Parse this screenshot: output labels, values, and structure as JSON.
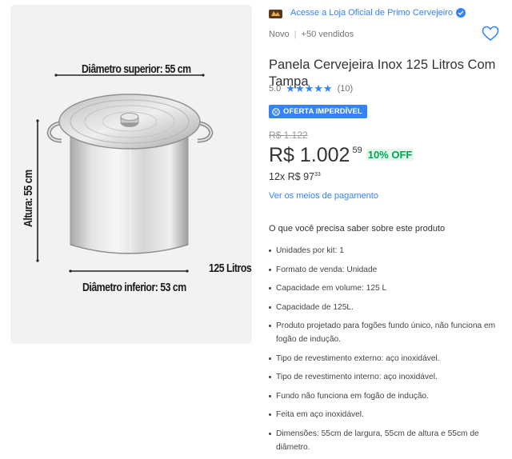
{
  "gallery": {
    "image_alt": "Panela cervejeira inox com tampa",
    "labels": {
      "top_diameter": "Diâmetro superior: 55 cm",
      "bottom_diameter": "Diâmetro inferior: 53 cm",
      "height": "Altura: 55 cm",
      "volume": "125 Litros"
    }
  },
  "store": {
    "link_text": "Acesse a Loja Oficial de Primo Cervejeiro"
  },
  "meta": {
    "condition": "Novo",
    "separator": "|",
    "sold": "+50 vendidos"
  },
  "product": {
    "title": "Panela Cervejeira Inox 125 Litros Com Tampa",
    "rating_value": "5.0",
    "rating_stars": "★★★★★",
    "rating_count": "(10)"
  },
  "deal_badge": "OFERTA IMPERDÍVEL",
  "pricing": {
    "old_price": "R$ 1.122",
    "price_main": "R$ 1.002",
    "price_cents": "59",
    "discount": "10% OFF",
    "installments_text": "12x R$ 97",
    "installments_cents": "33",
    "payment_link": "Ver os meios de pagamento"
  },
  "features": {
    "title": "O que você precisa saber sobre este produto",
    "items": [
      "Unidades por kit: 1",
      "Formato de venda: Unidade",
      "Capacidade em volume: 125 L",
      "Capacidade de 125L.",
      "Produto projetado para fogões fundo único, não funciona em fogão de indução.",
      "Tipo de revestimento externo: aço inoxidável.",
      "Tipo de revestimento interno: aço inoxidável.",
      "Fundo não funciona em fogão de indução.",
      "Feita em aço inoxidável.",
      "Dimensões: 55cm de largura, 55cm de altura e 55cm de diâmetro."
    ]
  },
  "colors": {
    "accent": "#3483fa",
    "discount_green": "#00a650"
  }
}
